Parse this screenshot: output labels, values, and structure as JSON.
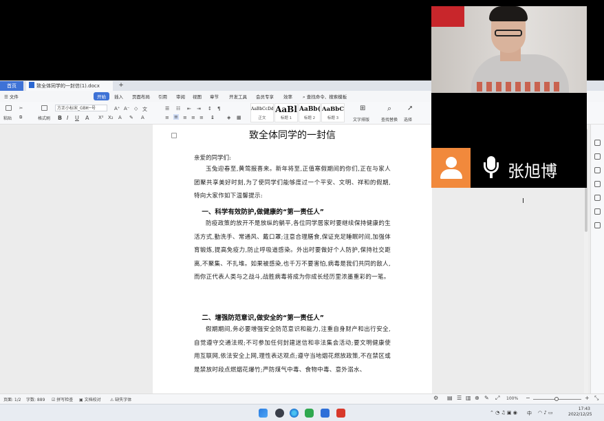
{
  "tabs": {
    "home": "首页",
    "doc": "致全体同学的一封信(1).docx",
    "add": "+"
  },
  "menu": {
    "file": "文件",
    "items": [
      "开始",
      "插入",
      "页面布局",
      "引用",
      "审阅",
      "视图",
      "章节",
      "开发工具",
      "会员专享",
      "效率"
    ],
    "search": "查找命令、搜索模板"
  },
  "toolbar": {
    "paste": "粘贴",
    "format_painter": "格式刷",
    "font_name": "方正小标宋_GBK",
    "font_size": "一号",
    "styles": [
      {
        "sample": "AaBbCcDd",
        "label": "正文"
      },
      {
        "sample": "AaBl",
        "label": "标题 1"
      },
      {
        "sample": "AaBb(",
        "label": "标题 2"
      },
      {
        "sample": "AaBbC",
        "label": "标题 3"
      }
    ],
    "text_layout": "文字排版",
    "find_replace": "查找替换",
    "select": "选择"
  },
  "document": {
    "title": "致全体同学的一封信",
    "greeting": "亲爱的同学们:",
    "p1": "玉兔迎春至,黄莺报喜来。新年将至,正值寒假期间的你们,正在与家人团聚共享美好时刻,为了使同学们能够度过一个平安、文明、祥和的假期,特向大家作如下温馨提示:",
    "h1": "一、科学有效防护,做健康的“第一责任人”",
    "p2": "防疫政策的放开不是放纵的躺平,各位同学居家时要继续保持健康的生活方式,勤洗手、常通风、戴口罩;注意合理膳食,保证充足睡眠时间,加强体育锻炼,提高免疫力,防止呼吸道感染。外出时要做好个人防护,保持社交距离,不聚集、不扎堆。如果被感染,也千万不要害怕,病毒是我们共同的敌人,而你正代表人类与之战斗,战胜病毒将成为你成长经历里浓墨重彩的一笔。",
    "h2": "二、增强防范意识,做安全的“第一责任人”",
    "p3": "假期期间,务必要增强安全防范意识和能力,注重自身财产和出行安全,自觉遵守交通法规;不可参加任何封建迷信和非法集会活动;要文明健康使用互联网,依法安全上网,理性表达观点;遵守当地烟花燃放政策,不在禁区或是禁放时段点燃烟花爆竹;严防煤气中毒、食物中毒、意外溺水、"
  },
  "status": {
    "page": "页面: 1/2",
    "words": "字数: 889",
    "spell": "拼写检查",
    "proof": "文档校对",
    "missing_font": "缺失字体",
    "zoom": "100%"
  },
  "taskbar": {
    "time": "17:43",
    "date": "2022/12/25",
    "ime": "中"
  },
  "video": {
    "speaker_name": "张旭博"
  },
  "colors": {
    "accent": "#3e72d6",
    "avatar": "#f1893c"
  }
}
